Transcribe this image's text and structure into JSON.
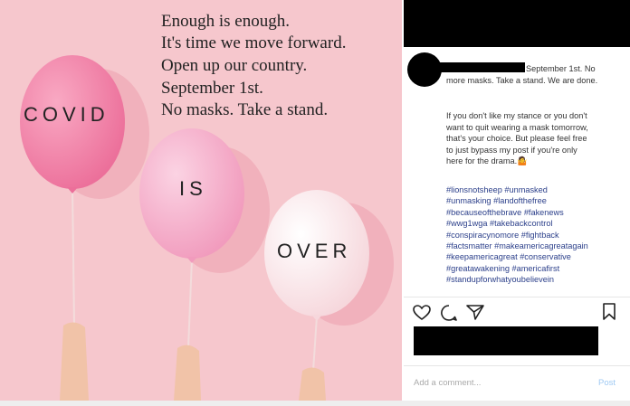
{
  "image": {
    "overlay_lines": [
      "Enough is enough.",
      "It's time we move forward.",
      "Open up our country.",
      "September 1st.",
      "No masks. Take a stand."
    ],
    "balloons": [
      "COVID",
      "IS",
      "OVER"
    ],
    "background_color": "#f6c7cd"
  },
  "post": {
    "caption_part1": "September 1st. No more masks. Take a stand. We are done.",
    "caption_part2": "If you don't like my stance or you don't want to quit wearing a mask tomorrow, that's your choice. But please feel free to just bypass my post if you're only here for the drama.🤷",
    "hashtags": [
      "#lionsnotsheep #unmasked",
      "#unmasking #landofthefree",
      "#becauseofthebrave #fakenews",
      "#wwg1wga #takebackcontrol",
      "#conspiracynomore #fightback",
      "#factsmatter #makeamericagreatagain",
      "#keepamericagreat #conservative",
      "#greatawakening #americafirst",
      "#standupforwhatyoubelievein"
    ],
    "comment_placeholder": "Add a comment...",
    "post_button": "Post",
    "icons": [
      "heart-icon",
      "comment-icon",
      "share-icon",
      "bookmark-icon"
    ]
  }
}
